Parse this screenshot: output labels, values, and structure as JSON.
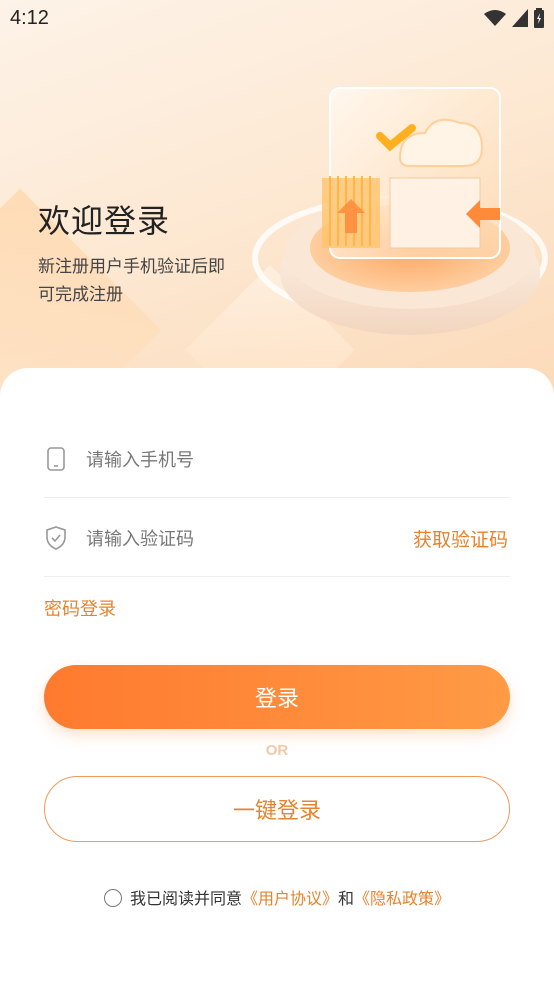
{
  "status": {
    "time": "4:12"
  },
  "welcome": {
    "title": "欢迎登录",
    "subtitle": "新注册用户手机验证后即可完成注册"
  },
  "phone_field": {
    "placeholder": "请输入手机号",
    "icon": "phone-icon"
  },
  "code_field": {
    "placeholder": "请输入验证码",
    "icon": "shield-check-icon",
    "get_code_label": "获取验证码"
  },
  "password_login_label": "密码登录",
  "login_button_label": "登录",
  "or_label": "OR",
  "one_key_login_label": "一键登录",
  "agreement": {
    "prefix": "我已阅读并同意",
    "user_agreement": "《用户协议》",
    "and": "和",
    "privacy_policy": "《隐私政策》",
    "checked": false
  },
  "colors": {
    "accent": "#e7832c",
    "button_start": "#ff7a2e",
    "button_end": "#ff9a45"
  }
}
